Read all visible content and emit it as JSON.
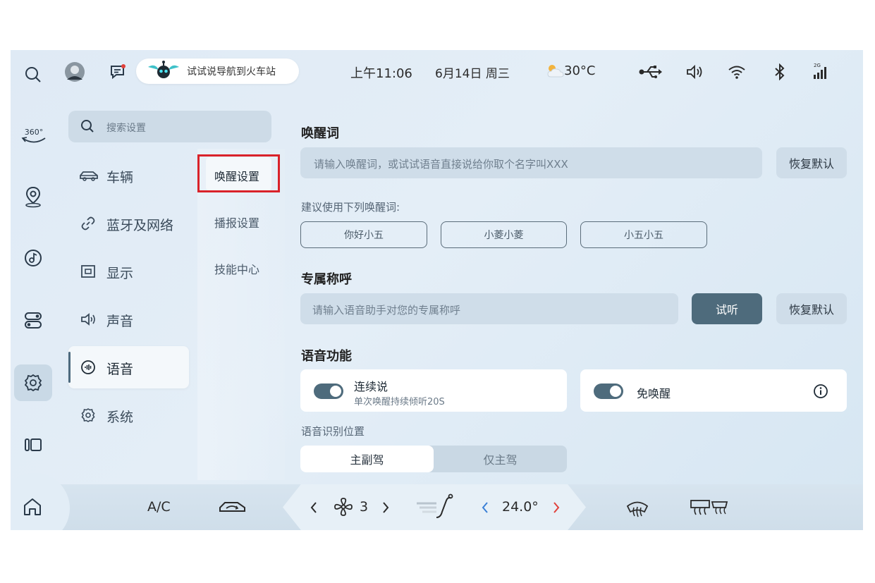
{
  "status_bar": {
    "voice_hint": "试试说导航到火车站",
    "time": "上午11:06",
    "date": "6月14日 周三",
    "temperature": "30°C"
  },
  "rail": {
    "items": [
      "search-icon",
      "360-view-icon",
      "map-pin-icon",
      "music-icon",
      "toggles-icon",
      "gear-icon",
      "apps-icon"
    ],
    "view_360_label": "360°"
  },
  "search": {
    "placeholder": "搜索设置"
  },
  "categories": [
    {
      "label": "车辆",
      "icon": "car-icon"
    },
    {
      "label": "蓝牙及网络",
      "icon": "link-icon"
    },
    {
      "label": "显示",
      "icon": "display-icon"
    },
    {
      "label": "声音",
      "icon": "speaker-icon"
    },
    {
      "label": "语音",
      "icon": "voice-icon",
      "selected": true
    },
    {
      "label": "系统",
      "icon": "gear-icon"
    }
  ],
  "submenu": [
    {
      "label": "唤醒设置",
      "selected": true
    },
    {
      "label": "播报设置"
    },
    {
      "label": "技能中心"
    }
  ],
  "wake_word": {
    "title": "唤醒词",
    "placeholder": "请输入唤醒词，或试试语音直接说给你取个名字叫XXX",
    "reset_label": "恢复默认",
    "suggest_label": "建议使用下列唤醒词:",
    "suggestions": [
      "你好小五",
      "小菱小菱",
      "小五小五"
    ]
  },
  "nickname": {
    "title": "专属称呼",
    "placeholder": "请输入语音助手对您的专属称呼",
    "try_label": "试听",
    "reset_label": "恢复默认"
  },
  "voice_features": {
    "title": "语音功能",
    "continuous": {
      "label": "连续说",
      "sub": "单次唤醒持续倾听20S",
      "on": true
    },
    "wake_free": {
      "label": "免唤醒",
      "on": true
    }
  },
  "recognition_position": {
    "title": "语音识别位置",
    "options": [
      "主副驾",
      "仅主驾"
    ],
    "selected": "主副驾"
  },
  "bottom_bar": {
    "ac_label": "A/C",
    "fan_level": "3",
    "temp_setting": "24.0°"
  },
  "colors": {
    "accent": "#4e6b7c",
    "highlight_box": "#d9222a",
    "temp_right_arrow": "#e0403a",
    "temp_left_arrow": "#3a7fd6"
  }
}
